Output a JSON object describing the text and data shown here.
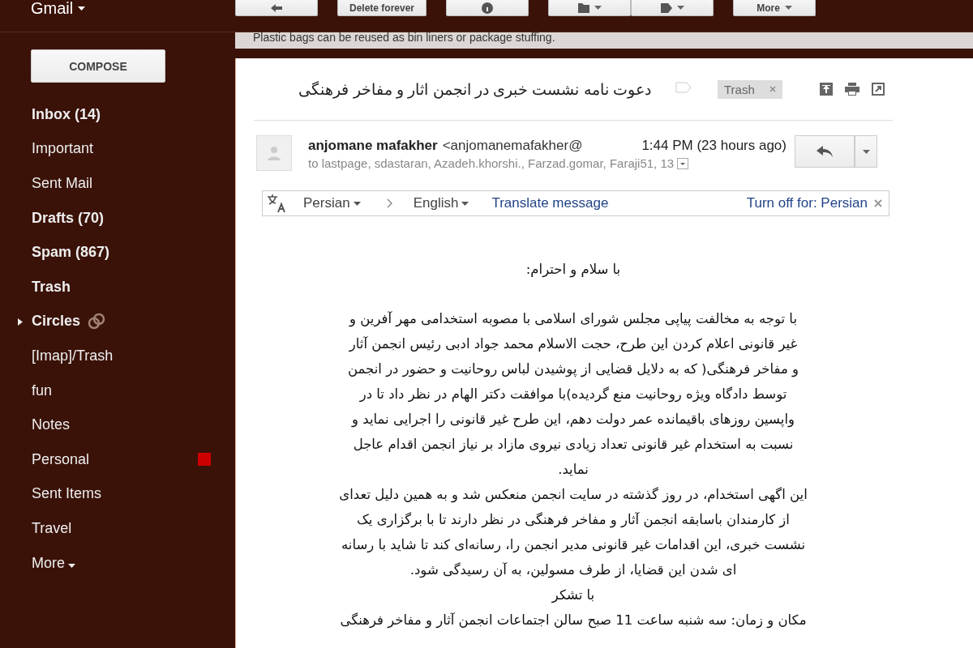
{
  "header": {
    "app_name": "Gmail",
    "delete_button": "Delete forever",
    "more_button": "More"
  },
  "tip": "Plastic bags can be reused as bin liners or package stuffing.",
  "sidebar": {
    "compose": "COMPOSE",
    "items": [
      {
        "label": "Inbox (14)",
        "unread": true,
        "kind": "label"
      },
      {
        "label": "Important",
        "unread": false,
        "kind": "label"
      },
      {
        "label": "Sent Mail",
        "unread": false,
        "kind": "label"
      },
      {
        "label": "Drafts (70)",
        "unread": true,
        "kind": "label"
      },
      {
        "label": "Spam (867)",
        "unread": true,
        "kind": "label"
      },
      {
        "label": "Trash",
        "unread": true,
        "kind": "label"
      },
      {
        "label": "Circles",
        "unread": true,
        "kind": "group",
        "expanded": false
      },
      {
        "label": "[Imap]/Trash",
        "unread": false,
        "kind": "label"
      },
      {
        "label": "fun",
        "unread": false,
        "kind": "label"
      },
      {
        "label": "Notes",
        "unread": false,
        "kind": "label"
      },
      {
        "label": "Personal",
        "unread": false,
        "kind": "label",
        "color": "#cc0000"
      },
      {
        "label": "Sent Items",
        "unread": false,
        "kind": "label"
      },
      {
        "label": "Travel",
        "unread": false,
        "kind": "label"
      },
      {
        "label": "More",
        "unread": false,
        "kind": "more"
      }
    ]
  },
  "message": {
    "subject": "دعوت نامه نشست خبری در انجمن اثار و مفاخر فرهنگی",
    "important": false,
    "tag": "Trash",
    "sender_name": "anjomane mafakher",
    "sender_email": "<anjomanemafakher@",
    "time": "1:44 PM (23 hours ago)",
    "recipients": "to lastpage, sdastaran, Azadeh.khorshi., Farzad.gomar, Faraji51, 13",
    "translate": {
      "from": "Persian",
      "to": "English",
      "action": "Translate message",
      "turn_off": "Turn off for: Persian"
    },
    "greeting": "با سلام و احترام:",
    "body_lines": [
      "با توجه به مخالفت پیاپی مجلس شورای اسلامی با مصوبه استخدامی مهر آفرین و",
      "غیر قانونی اعلام کردن این طرح، حجت الاسلام محمد جواد ادبی رئیس انجمن آثار",
      "و مفاخر فرهنگی( که به دلایل قضایی از پوشیدن لباس روحانیت و حضور در انجمن",
      "توسط دادگاه ویژه روحانیت منع گردیده)با موافقت دکتر الهام در نظر داد تا در",
      "واپسین روزهای باقیمانده عمر دولت دهم، این طرح غیر قانونی را اجرایی نماید و",
      "نسبت به استخدام غیر قانونی تعداد زیادی نیروی مازاد بر نیاز انجمن اقدام عاجل",
      "نماید.",
      "این اگهی استخدام، در روز گذشته در سایت انجمن منعکس شد و به همین دلیل تعدای",
      "از کارمندان باسابقه انجمن آثار و مفاخر فرهنگی در نظر دارند تا با برگزاری یک",
      "نشست خبری، این اقدامات غیر قانونی مدیر انجمن را، رسانه‌ای کند تا شاید با رسانه",
      "ای شدن این قضایا، از طرف مسولین، به آن رسیدگی شود.",
      "با تشکر",
      "مکان و زمان: سه شنبه ساعت 11 صبح سالن اجتماعات انجمن آثار و مفاخر فرهنگی"
    ]
  }
}
